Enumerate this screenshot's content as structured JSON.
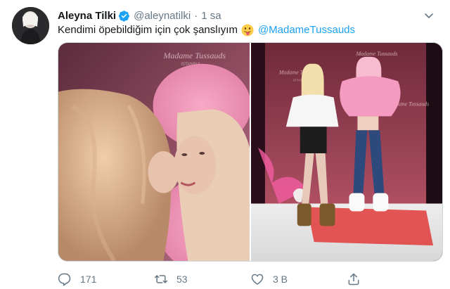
{
  "tweet": {
    "author_name": "Aleyna Tilki",
    "handle": "@aleynatilki",
    "separator": "·",
    "time": "1 sa",
    "text": "Kendimi öpebildiğim için çok şanslıyım",
    "mention": "@MadameTussauds"
  },
  "media": {
    "left_photo_wall_text": [
      "Madame Tussauds",
      "ISTANBUL"
    ],
    "right_photo_wall_text": [
      "Madame Tussauds",
      "ISTANBUL"
    ]
  },
  "actions": {
    "reply_count": "171",
    "retweet_count": "53",
    "like_count": "3 B",
    "share_label": ""
  },
  "icons": {
    "verified": "verified-badge-icon",
    "emoji": "tongue-out-emoji",
    "reply": "reply-icon",
    "retweet": "retweet-icon",
    "like": "heart-icon",
    "share": "share-icon",
    "caret": "chevron-down-icon"
  },
  "colors": {
    "accent": "#1da1f2",
    "secondary_text": "#657786",
    "primary_text": "#14171a",
    "border": "#ccd6dd"
  }
}
